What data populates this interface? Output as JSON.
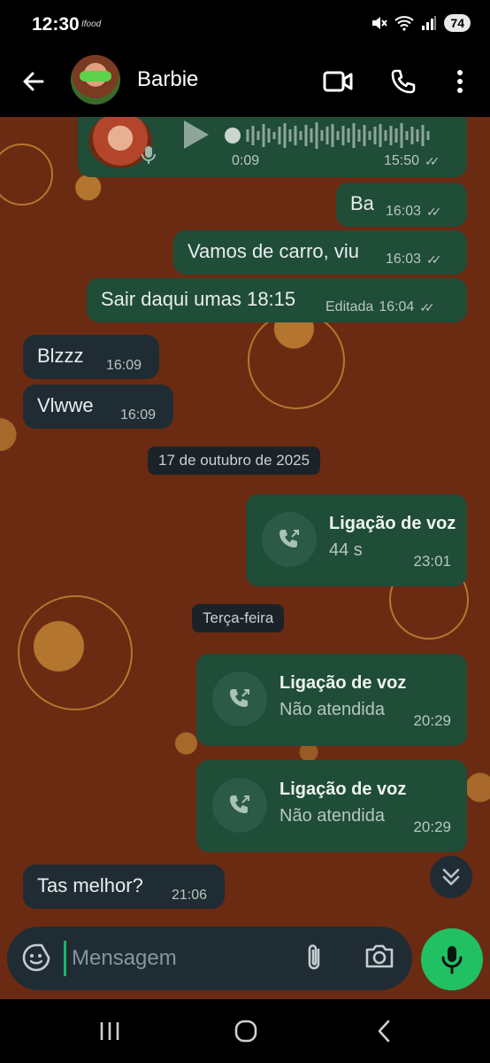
{
  "status_bar": {
    "time": "12:30",
    "app_tag": "Ifood",
    "battery": "74"
  },
  "header": {
    "contact_name": "Barbie"
  },
  "messages": {
    "voice": {
      "duration": "0:09",
      "time": "15:50"
    },
    "m1": {
      "text": "Ba",
      "time": "16:03"
    },
    "m2": {
      "text": "Vamos de carro, viu",
      "time": "16:03"
    },
    "m3": {
      "text": "Sair daqui umas 18:15",
      "edited": "Editada",
      "time": "16:04"
    },
    "m4": {
      "text": "Blzzz",
      "time": "16:09"
    },
    "m5": {
      "text": "Vlwwe",
      "time": "16:09"
    },
    "date1": "17 de outubro de 2025",
    "call1": {
      "title": "Ligação de voz",
      "sub": "44 s",
      "time": "23:01"
    },
    "date2": "Terça-feira",
    "call2": {
      "title": "Ligação de voz",
      "sub": "Não atendida",
      "time": "20:29"
    },
    "call3": {
      "title": "Ligação de voz",
      "sub": "Não atendida",
      "time": "20:29"
    },
    "m6": {
      "text": "Tas melhor?",
      "time": "21:06"
    }
  },
  "composer": {
    "placeholder": "Mensagem"
  },
  "icons": [
    "back-arrow-icon",
    "video-call-icon",
    "phone-icon",
    "more-vertical-icon",
    "play-icon",
    "mic-icon",
    "double-check-icon",
    "call-outgoing-icon",
    "chevrons-down-icon",
    "sticker-icon",
    "attach-icon",
    "camera-icon",
    "recents-icon",
    "home-icon",
    "back-nav-icon"
  ],
  "colors": {
    "outgoing_bubble": "#1f4d38",
    "incoming_bubble": "#1f2c33",
    "accent_green": "#21c063",
    "wallpaper": "#6b2a12"
  }
}
